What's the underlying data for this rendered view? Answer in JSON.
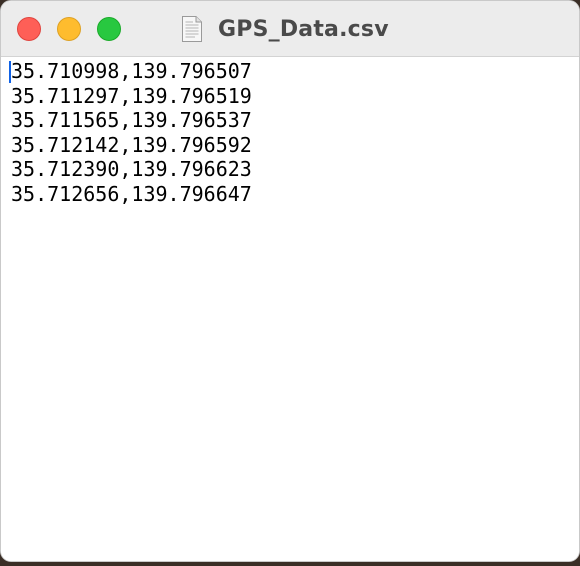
{
  "window": {
    "title": "GPS_Data.csv"
  },
  "document": {
    "lines": [
      "35.710998,139.796507",
      "35.711297,139.796519",
      "35.711565,139.796537",
      "35.712142,139.796592",
      "35.712390,139.796623",
      "35.712656,139.796647"
    ]
  },
  "icons": {
    "close": "close-icon",
    "minimize": "minimize-icon",
    "zoom": "zoom-icon",
    "document": "document-icon"
  },
  "colors": {
    "close": "#fe5f57",
    "minimize": "#febc2e",
    "zoom": "#28c840",
    "caret": "#1062e6"
  }
}
